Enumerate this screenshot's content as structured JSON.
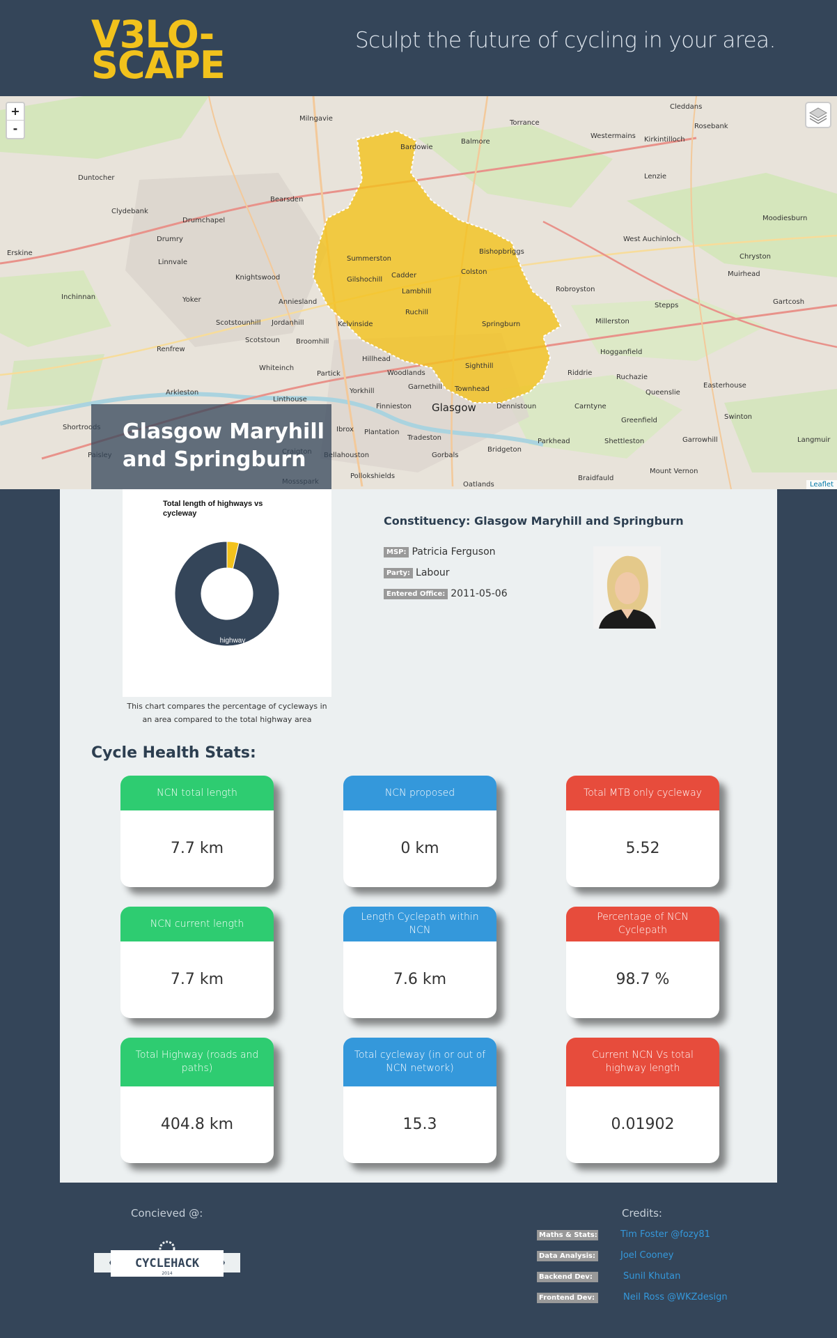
{
  "header": {
    "logo_line1": "V3LO-",
    "logo_line2": "SCAPE",
    "tagline": "Sculpt the future of cycling in your area."
  },
  "map": {
    "zoom_in": "+",
    "zoom_out": "-",
    "attribution": "Leaflet",
    "area_title": "Glasgow Maryhill and Springburn",
    "places": [
      "Milngavie",
      "Torrance",
      "Cleddans",
      "Rosebank",
      "Westermains",
      "Kirkintilloch",
      "Bardowie",
      "Balmore",
      "Duntocher",
      "Clydebank",
      "Bearsden",
      "Lenzie",
      "Drumchapel",
      "Drumry",
      "Moodiesburn",
      "Bishopbriggs",
      "West Auchinloch",
      "Chryston",
      "Erskine",
      "Linnvale",
      "Knightswood",
      "Summerston",
      "Gilshochill",
      "Cadder",
      "Colston",
      "Muirhead",
      "Inchinnan",
      "Yoker",
      "Anniesland",
      "Lambhill",
      "Robroyston",
      "Gartcosh",
      "Ruchill",
      "Stepps",
      "Scotstounhill",
      "Jordanhill",
      "Kelvinside",
      "Millerston",
      "Springburn",
      "Renfrew",
      "Scotstoun",
      "Broomhill",
      "Hogganfield",
      "Hillhead",
      "Sighthill",
      "Whiteinch",
      "Partick",
      "Woodlands",
      "Riddrie",
      "Ruchazie",
      "Easterhouse",
      "Arkleston",
      "Yorkhill",
      "Garnethill",
      "Townhead",
      "Queenslie",
      "Linthouse",
      "Finnieston",
      "Glasgow",
      "Dennistoun",
      "Carntyne",
      "Greenfield",
      "Swinton",
      "Shortroods",
      "Ibrox",
      "Plantation",
      "Tradeston",
      "Parkhead",
      "Shettleston",
      "Garrowhill",
      "Langmuir",
      "Paisley",
      "Craigton",
      "Bellahouston",
      "Gorbals",
      "Bridgeton",
      "Pollokshields",
      "Mount Vernon",
      "Mossspark",
      "Oatlands",
      "Braidfauld"
    ]
  },
  "chart": {
    "caption": "This chart compares the percentage of cycleways in an area compared to the total highway area"
  },
  "chart_data": {
    "type": "pie",
    "title": "Total length of highways vs cycleway",
    "categories": [
      "highway",
      "cycleway"
    ],
    "values": [
      404.8,
      15.3
    ],
    "colors": [
      "#344559",
      "#f2c21c"
    ]
  },
  "constituency": {
    "title": "Constituency: Glasgow Maryhill and Springburn",
    "msp_label": "MSP:",
    "msp_value": "Patricia Ferguson",
    "party_label": "Party:",
    "party_value": "Labour",
    "office_label": "Entered Office:",
    "office_value": "2011-05-06"
  },
  "stats": {
    "heading": "Cycle Health Stats:",
    "cards": [
      {
        "label": "NCN total length",
        "value": "7.7 km",
        "color": "green"
      },
      {
        "label": "NCN proposed",
        "value": "0 km",
        "color": "blue"
      },
      {
        "label": "Total MTB only cycleway",
        "value": "5.52",
        "color": "red"
      },
      {
        "label": "NCN current length",
        "value": "7.7 km",
        "color": "green"
      },
      {
        "label": "Length Cyclepath within NCN",
        "value": "7.6 km",
        "color": "blue"
      },
      {
        "label": "Percentage of NCN Cyclepath",
        "value": "98.7 %",
        "color": "red"
      },
      {
        "label": "Total Highway (roads and paths)",
        "value": "404.8 km",
        "color": "green"
      },
      {
        "label": "Total cycleway (in or out of NCN network)",
        "value": "15.3",
        "color": "blue"
      },
      {
        "label": "Current NCN Vs total highway length",
        "value": "0.01902",
        "color": "red"
      }
    ]
  },
  "footer": {
    "conceived": "Concieved @:",
    "cyclehack_text": "CYCLEHACK",
    "cyclehack_year": "2014",
    "credits_heading": "Credits:",
    "credits": [
      {
        "role": "Maths & Stats:",
        "name": "Tim Foster",
        "handle": "@fozy81"
      },
      {
        "role": "Data Analysis:",
        "name": "Joel Cooney",
        "handle": ""
      },
      {
        "role": "Backend Dev:",
        "name": "Sunil Khutan",
        "handle": ""
      },
      {
        "role": "Frontend Dev:",
        "name": "Neil Ross",
        "handle": "@WKZdesign"
      }
    ]
  },
  "colors": {
    "background": "#344559",
    "accent": "#f2c21c",
    "green": "#2ecc71",
    "blue": "#3498db",
    "red": "#e74c3c"
  }
}
